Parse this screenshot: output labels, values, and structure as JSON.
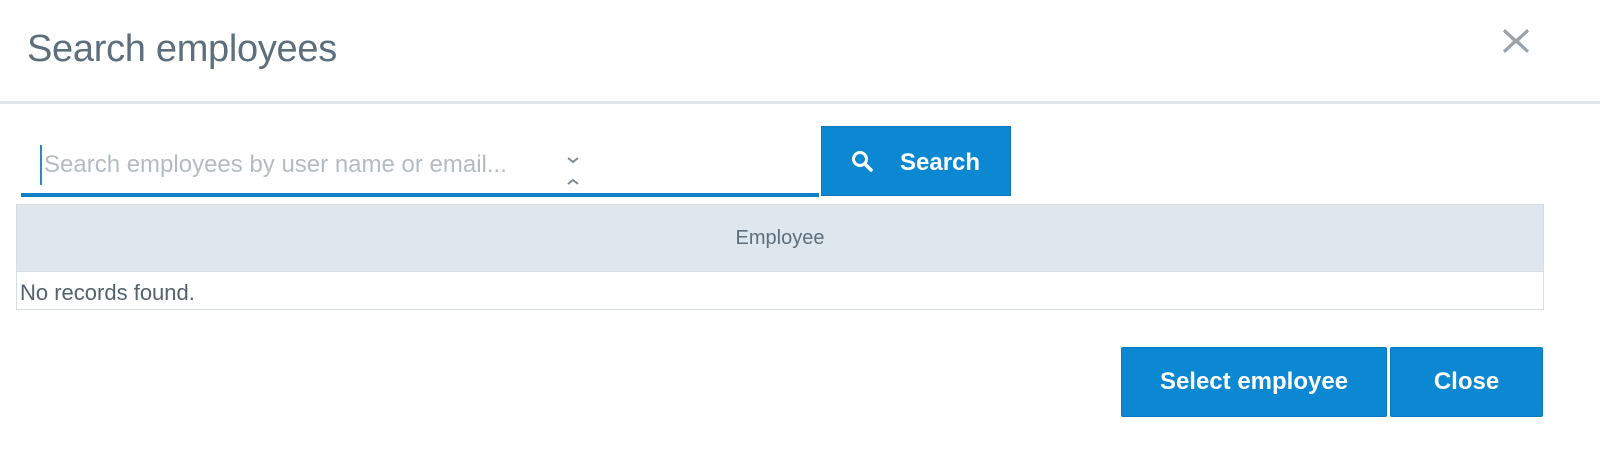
{
  "dialog": {
    "title": "Search employees",
    "close_icon": "close-icon"
  },
  "search": {
    "placeholder": "Search employees by user name or email...",
    "value": "",
    "button_label": "Search",
    "button_icon": "search-icon"
  },
  "table": {
    "columns": [
      "Employee"
    ],
    "empty_message": "No records found."
  },
  "footer": {
    "select_label": "Select employee",
    "close_label": "Close"
  },
  "colors": {
    "primary": "#0c87d2",
    "header_bg": "#dfe7ee",
    "title_text": "#5d6f7c"
  }
}
